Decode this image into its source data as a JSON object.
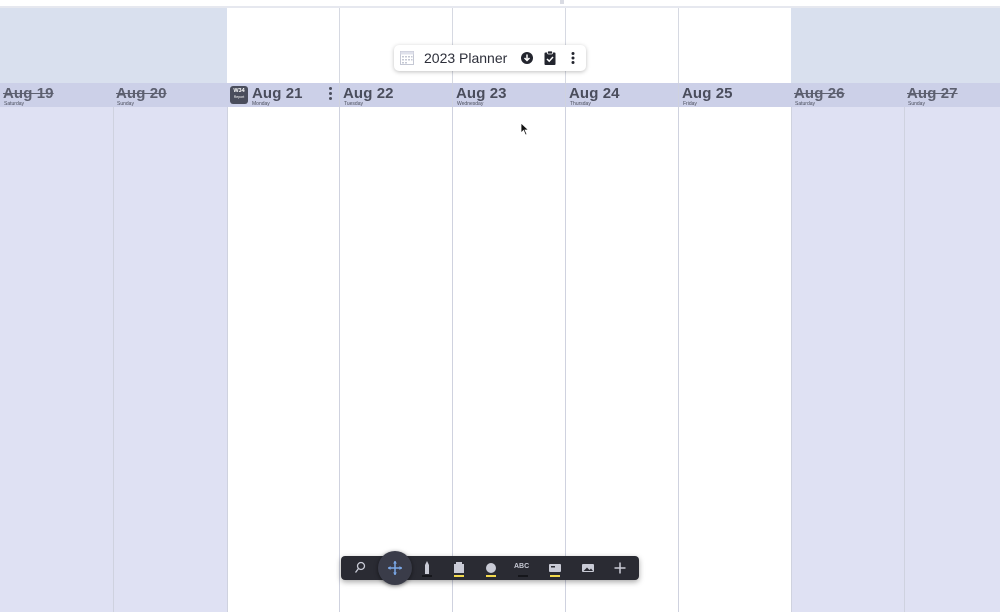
{
  "planner": {
    "title": "2023 Planner",
    "icons": {
      "calendar": "calendar-icon",
      "download": "download-icon",
      "tasks": "clipboard-check-icon",
      "menu": "more-vertical-icon"
    }
  },
  "week_badge": {
    "label": "W34",
    "sub": "Report"
  },
  "days": [
    {
      "date": "Aug 19",
      "weekday": "Saturday",
      "weekend": true
    },
    {
      "date": "Aug 20",
      "weekday": "Sunday",
      "weekend": true
    },
    {
      "date": "Aug 21",
      "weekday": "Monday",
      "weekend": false
    },
    {
      "date": "Aug 22",
      "weekday": "Tuesday",
      "weekend": false
    },
    {
      "date": "Aug 23",
      "weekday": "Wednesday",
      "weekend": false
    },
    {
      "date": "Aug 24",
      "weekday": "Thursday",
      "weekend": false
    },
    {
      "date": "Aug 25",
      "weekday": "Friday",
      "weekend": false
    },
    {
      "date": "Aug 26",
      "weekday": "Saturday",
      "weekend": true
    },
    {
      "date": "Aug 27",
      "weekday": "Sunday",
      "weekend": true
    }
  ],
  "toolbar": {
    "tools": [
      {
        "name": "lasso-tool",
        "icon": "lasso-icon"
      },
      {
        "name": "move-tool",
        "icon": "move-arrows-icon",
        "active": true
      },
      {
        "name": "pen-tool",
        "icon": "pen-icon",
        "underline": "#2a2b33"
      },
      {
        "name": "highlighter-tool",
        "icon": "highlighter-icon",
        "underline": "#f2d94e"
      },
      {
        "name": "shape-tool",
        "icon": "circle-icon",
        "underline": "#f2d94e"
      },
      {
        "name": "text-tool",
        "icon": "text-icon",
        "label": "ABC",
        "underline": "#1b1c22"
      },
      {
        "name": "sticky-note-tool",
        "icon": "sticky-note-icon",
        "underline": "#f2d94e"
      },
      {
        "name": "image-tool",
        "icon": "image-icon"
      },
      {
        "name": "add-tool",
        "icon": "plus-icon"
      }
    ]
  },
  "colors": {
    "weekend_column": "#dfe1f3",
    "date_strip": "#ccd0e8",
    "toolbar_bg": "#2a2b33",
    "accent_yellow": "#f2d94e",
    "accent_blue": "#4a90e2"
  }
}
